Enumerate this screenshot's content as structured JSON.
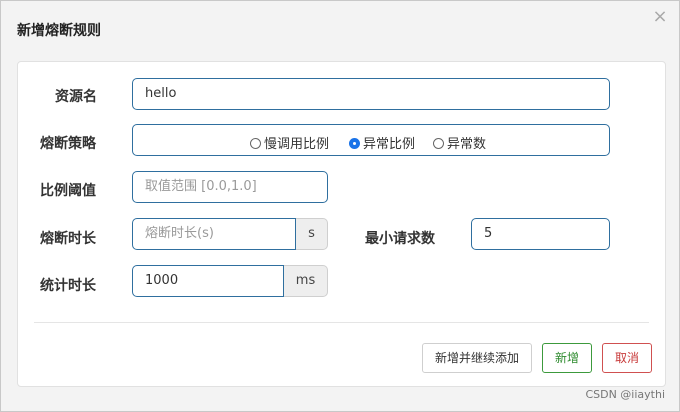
{
  "dialog": {
    "title": "新增熔断规则",
    "close_glyph": "×"
  },
  "form": {
    "resource_name": {
      "label": "资源名",
      "value": "hello"
    },
    "strategy": {
      "label": "熔断策略",
      "options": [
        {
          "label": "慢调用比例",
          "checked": false
        },
        {
          "label": "异常比例",
          "checked": true
        },
        {
          "label": "异常数",
          "checked": false
        }
      ]
    },
    "ratio_threshold": {
      "label": "比例阈值",
      "placeholder": "取值范围 [0.0,1.0]"
    },
    "break_duration": {
      "label": "熔断时长",
      "placeholder": "熔断时长(s)",
      "unit": "s"
    },
    "min_request": {
      "label": "最小请求数",
      "value": "5"
    },
    "stat_duration": {
      "label": "统计时长",
      "value": "1000",
      "unit": "ms"
    }
  },
  "footer": {
    "add_continue_label": "新增并继续添加",
    "add_label": "新增",
    "cancel_label": "取消"
  },
  "watermark": "CSDN @iiaythi",
  "colors": {
    "input_border": "#2f6f9f",
    "success": "#2e8b2e",
    "danger": "#c83a3a",
    "radio_checked": "#1a73e8"
  }
}
